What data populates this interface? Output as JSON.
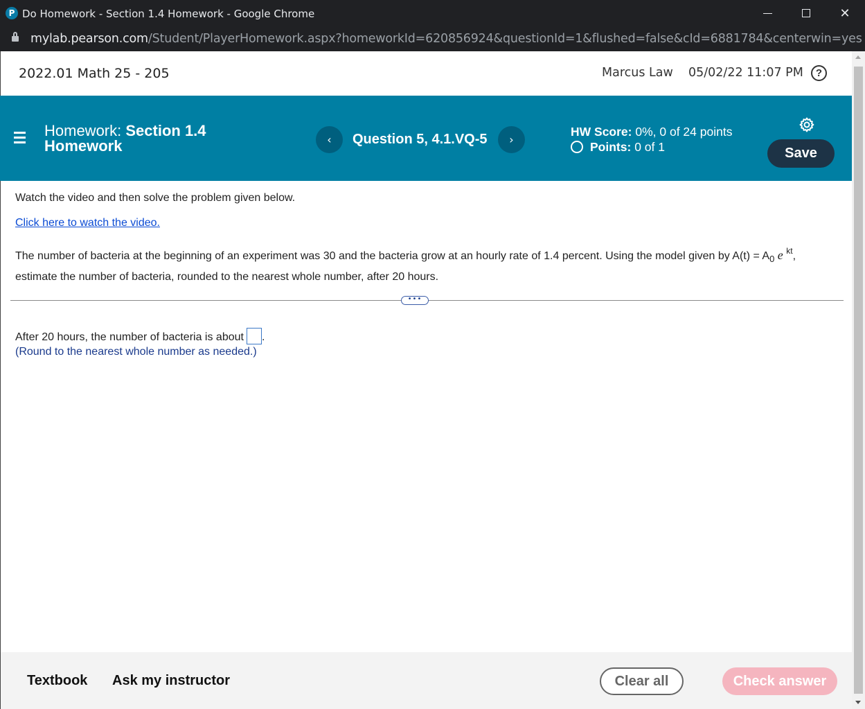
{
  "window": {
    "app_icon": "P",
    "title": "Do Homework - Section 1.4 Homework - Google Chrome",
    "close_glyph": "✕"
  },
  "address_bar": {
    "host": "mylab.pearson.com",
    "path": "/Student/PlayerHomework.aspx?homeworkId=620856924&questionId=1&flushed=false&cId=6881784&centerwin=yes"
  },
  "header": {
    "course": "2022.01 Math 25 - 205",
    "user": "Marcus Law",
    "datetime": "05/02/22 11:07 PM",
    "help_glyph": "?"
  },
  "banner": {
    "homework_prefix": "Homework:",
    "homework_section": "Section 1.4",
    "homework_word": "Homework",
    "prev_glyph": "‹",
    "next_glyph": "›",
    "question": "Question 5, 4.1.VQ-5",
    "hw_score_label": "HW Score:",
    "hw_score_value": "0%, 0 of 24 points",
    "points_label": "Points:",
    "points_value": "0 of 1",
    "save_label": "Save",
    "accent_color": "#007fa3"
  },
  "content": {
    "instruction": "Watch the video and then solve the problem given below.",
    "video_link": "Click here to watch the video.",
    "problem_text_1": "The number of bacteria at the beginning of an experiment was 30 and the bacteria grow at an hourly rate of 1.4 percent. Using the model given by A(t) = A",
    "problem_sub": "0",
    "problem_e": "e",
    "problem_sup": "kt",
    "problem_text_2": ",",
    "problem_text_3": "estimate the number of bacteria, rounded to the nearest whole number, after 20 hours.",
    "expand_glyph": "•••",
    "answer_prefix": "After 20 hours, the number of bacteria is about",
    "answer_value": "",
    "answer_suffix": ".",
    "round_note": "(Round to the nearest whole number as needed.)"
  },
  "footer": {
    "textbook": "Textbook",
    "ask_instructor": "Ask my instructor",
    "clear_all": "Clear all",
    "check_answer": "Check answer"
  },
  "icons": {
    "menu": "menu-icon",
    "gear": "gear-icon",
    "help": "help-icon",
    "lock": "lock-icon"
  }
}
